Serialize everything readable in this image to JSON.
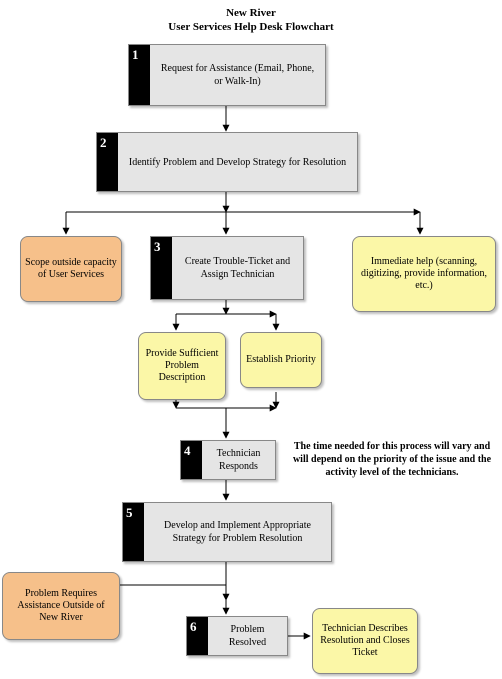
{
  "title": {
    "line1": "New River",
    "line2": "User Services Help Desk Flowchart"
  },
  "steps": {
    "s1": {
      "num": "1",
      "text": "Request for Assistance (Email, Phone, or Walk-In)"
    },
    "s2": {
      "num": "2",
      "text": "Identify Problem and Develop Strategy for Resolution"
    },
    "s3": {
      "num": "3",
      "text": "Create Trouble-Ticket and Assign Technician"
    },
    "s4": {
      "num": "4",
      "text": "Technician Responds"
    },
    "s5": {
      "num": "5",
      "text": "Develop and Implement Appropriate Strategy for Problem Resolution"
    },
    "s6": {
      "num": "6",
      "text": "Problem Resolved"
    }
  },
  "branches": {
    "scope_out": "Scope outside capacity of User Services",
    "immediate": "Immediate help (scanning, digitizing, provide information, etc.)",
    "description": "Provide Sufficient Problem Description",
    "priority": "Establish Priority",
    "outside_nr": "Problem Requires Assistance Outside of New River",
    "closes": "Technician Describes Resolution and Closes Ticket"
  },
  "note": "The time needed for this process will vary and will depend on the priority of the issue and the activity level of the technicians.",
  "chart_data": {
    "type": "flowchart",
    "nodes": [
      {
        "id": "1",
        "kind": "step",
        "label": "Request for Assistance (Email, Phone, or Walk-In)"
      },
      {
        "id": "2",
        "kind": "step",
        "label": "Identify Problem and Develop Strategy for Resolution"
      },
      {
        "id": "scope_out",
        "kind": "terminal",
        "label": "Scope outside capacity of User Services"
      },
      {
        "id": "immediate",
        "kind": "terminal",
        "label": "Immediate help (scanning, digitizing, provide information, etc.)"
      },
      {
        "id": "3",
        "kind": "step",
        "label": "Create Trouble-Ticket and Assign Technician"
      },
      {
        "id": "description",
        "kind": "sub",
        "label": "Provide Sufficient Problem Description"
      },
      {
        "id": "priority",
        "kind": "sub",
        "label": "Establish Priority"
      },
      {
        "id": "4",
        "kind": "step",
        "label": "Technician Responds"
      },
      {
        "id": "5",
        "kind": "step",
        "label": "Develop and Implement Appropriate Strategy for Problem Resolution"
      },
      {
        "id": "outside_nr",
        "kind": "terminal",
        "label": "Problem Requires Assistance Outside of New River"
      },
      {
        "id": "6",
        "kind": "step",
        "label": "Problem Resolved"
      },
      {
        "id": "closes",
        "kind": "terminal",
        "label": "Technician Describes Resolution and Closes Ticket"
      }
    ],
    "edges": [
      {
        "from": "1",
        "to": "2"
      },
      {
        "from": "2",
        "to": "scope_out"
      },
      {
        "from": "2",
        "to": "3"
      },
      {
        "from": "2",
        "to": "immediate"
      },
      {
        "from": "3",
        "to": "description"
      },
      {
        "from": "3",
        "to": "priority"
      },
      {
        "from": "description",
        "to": "4"
      },
      {
        "from": "priority",
        "to": "4"
      },
      {
        "from": "4",
        "to": "5"
      },
      {
        "from": "5",
        "to": "outside_nr"
      },
      {
        "from": "5",
        "to": "6"
      },
      {
        "from": "6",
        "to": "closes"
      }
    ],
    "annotations": [
      {
        "near": "4",
        "text": "The time needed for this process will vary and will depend on the priority of the issue and the activity level of the technicians."
      }
    ]
  }
}
